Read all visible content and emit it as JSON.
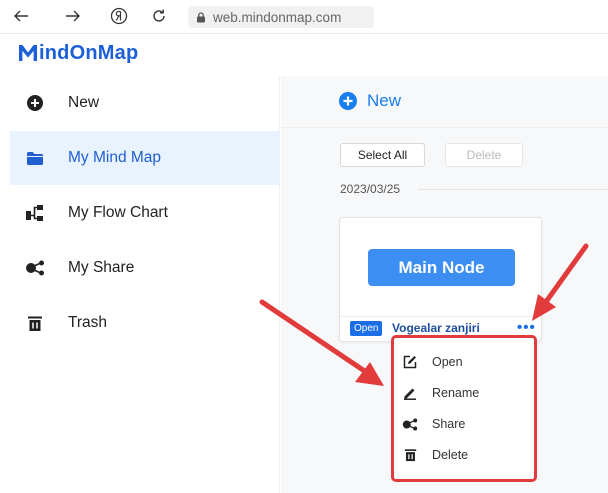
{
  "browser": {
    "url": "web.mindonmap.com"
  },
  "logo": {
    "text": "indOnMap",
    "brand_color": "#1b60d8"
  },
  "sidebar": {
    "items": [
      {
        "label": "New",
        "icon": "plus-circle-icon"
      },
      {
        "label": "My Mind Map",
        "icon": "folder-icon",
        "active": true
      },
      {
        "label": "My Flow Chart",
        "icon": "flowchart-icon"
      },
      {
        "label": "My Share",
        "icon": "share-icon"
      },
      {
        "label": "Trash",
        "icon": "trash-icon"
      }
    ],
    "active_bg": "#e8f3ff"
  },
  "main": {
    "new_label": "New",
    "select_all_label": "Select All",
    "delete_label": "Delete",
    "date": "2023/03/25",
    "card": {
      "node_label": "Main Node",
      "badge": "Open",
      "title": "Vogealar zanjiri",
      "more": "•••"
    }
  },
  "context_menu": {
    "items": [
      {
        "label": "Open",
        "icon": "edit-icon"
      },
      {
        "label": "Rename",
        "icon": "pencil-icon"
      },
      {
        "label": "Share",
        "icon": "share-icon"
      },
      {
        "label": "Delete",
        "icon": "trash-icon"
      }
    ],
    "highlight_color": "#e23b3b"
  },
  "accent_color": "#1a7ef0"
}
